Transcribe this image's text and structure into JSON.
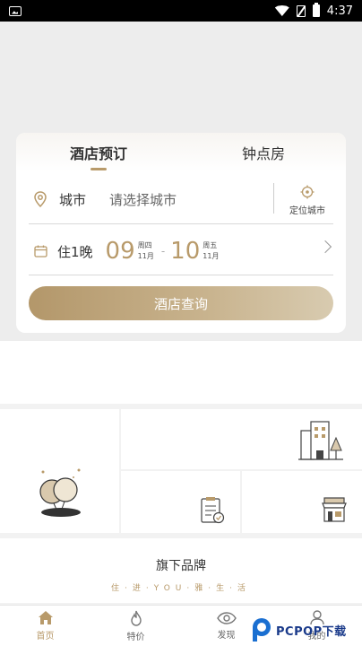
{
  "status_bar": {
    "time": "4:37"
  },
  "booking": {
    "tabs": [
      {
        "label": "酒店预订",
        "active": true
      },
      {
        "label": "钟点房",
        "active": false
      }
    ],
    "city_label": "城市",
    "city_placeholder": "请选择城市",
    "locate_label": "定位城市",
    "nights": "住1晚",
    "checkin": {
      "day": "09",
      "weekday": "周四",
      "month": "11月"
    },
    "checkout": {
      "day": "10",
      "weekday": "周五",
      "month": "11月"
    },
    "date_separator": "-",
    "query_button": "酒店查询"
  },
  "brand": {
    "title": "旗下品牌",
    "slogan": "住·进·YOU·雅·生·活"
  },
  "tabbar": [
    {
      "label": "首页",
      "icon": "home-icon",
      "active": true
    },
    {
      "label": "特价",
      "icon": "flame-icon",
      "active": false
    },
    {
      "label": "发现",
      "icon": "eye-icon",
      "active": false
    },
    {
      "label": "我的",
      "icon": "user-icon",
      "active": false
    }
  ],
  "watermark": {
    "text": "PCPOP下载"
  },
  "colors": {
    "accent": "#b89a6a",
    "background": "#ededed"
  }
}
